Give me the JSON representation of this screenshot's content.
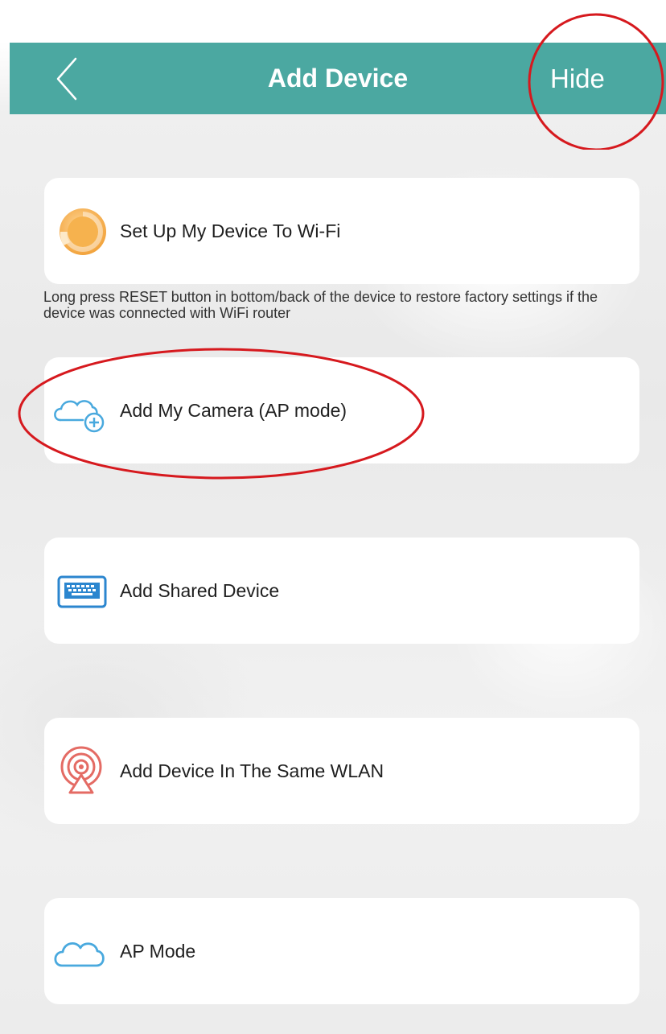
{
  "header": {
    "title": "Add Device",
    "hide_label": "Hide",
    "bar_color": "#4ba8a1"
  },
  "options": [
    {
      "label": "Set Up My Device To Wi-Fi",
      "icon": "wifi-setup-icon"
    },
    {
      "label": "Add My Camera (AP mode)",
      "icon": "cloud-add-icon"
    },
    {
      "label": "Add Shared Device",
      "icon": "keyboard-icon"
    },
    {
      "label": "Add Device In The Same WLAN",
      "icon": "wlan-signal-icon"
    },
    {
      "label": "AP Mode",
      "icon": "cloud-icon"
    }
  ],
  "hint": "Long press RESET button in bottom/back of the device to restore factory settings if the device was connected with WiFi router",
  "annotation_color": "#d6191e"
}
